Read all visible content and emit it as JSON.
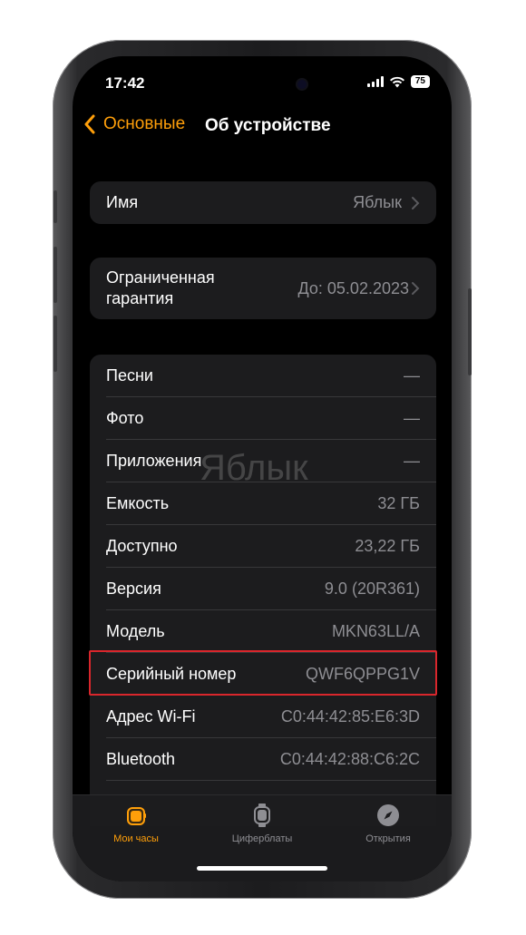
{
  "status_bar": {
    "time": "17:42",
    "battery": "75"
  },
  "nav": {
    "back_label": "Основные",
    "title": "Об устройстве"
  },
  "groups": {
    "name": {
      "label": "Имя",
      "value": "Яблык"
    },
    "warranty": {
      "label_line1": "Ограниченная",
      "label_line2": "гарантия",
      "value": "До: 05.02.2023"
    }
  },
  "info_rows": [
    {
      "label": "Песни",
      "value": "—"
    },
    {
      "label": "Фото",
      "value": "—"
    },
    {
      "label": "Приложения",
      "value": "—"
    },
    {
      "label": "Емкость",
      "value": "32 ГБ"
    },
    {
      "label": "Доступно",
      "value": "23,22 ГБ"
    },
    {
      "label": "Версия",
      "value": "9.0 (20R361)"
    },
    {
      "label": "Модель",
      "value": "MKN63LL/A"
    },
    {
      "label": "Серийный номер",
      "value": "QWF6QPPG1V"
    },
    {
      "label": "Адрес Wi-Fi",
      "value": "C0:44:42:85:E6:3D"
    },
    {
      "label": "Bluetooth",
      "value": "C0:44:42:88:C6:2C"
    }
  ],
  "watermark": "Яблык",
  "tabs": [
    {
      "label": "Мои часы",
      "icon": "watch-icon",
      "active": true
    },
    {
      "label": "Циферблаты",
      "icon": "watch-face-icon",
      "active": false
    },
    {
      "label": "Открытия",
      "icon": "compass-icon",
      "active": false
    }
  ],
  "colors": {
    "accent": "#ff9f0a",
    "highlight": "#d9262c",
    "background": "#000000",
    "cell": "#1c1c1e"
  }
}
